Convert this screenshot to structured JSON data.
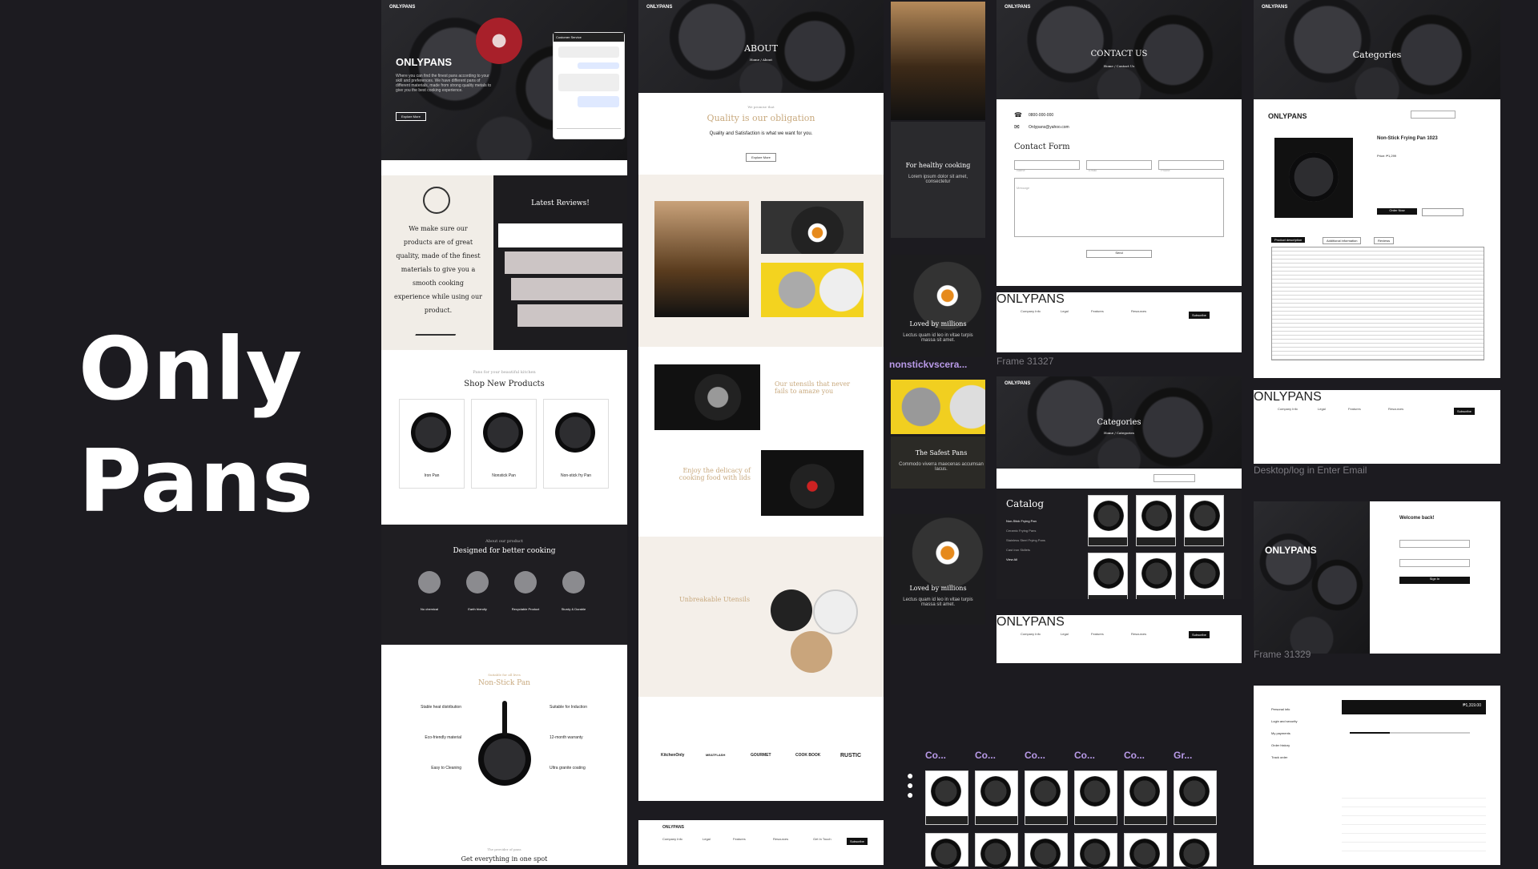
{
  "title": {
    "line1": "Only",
    "line2": "Pans"
  },
  "brand": "ONLYPANS",
  "col1": {
    "hero_text": "Where you can find the finest pans according to your skill and preferences. We have different pans of different materials, made from strong quality metals to give you the best cooking experience.",
    "hero_button": "Explore More",
    "chat_title": "Customer Service",
    "quote": "We make sure our products are of great quality, made of the finest materials to give you a smooth cooking experience while using our product.",
    "reviews_title": "Latest Reviews!",
    "shop_sub": "Pans for your beautiful kitchen",
    "shop_title": "Shop New Products",
    "products": [
      "Iron Pan",
      "Nonstick Pan",
      "Non-stick fry Pan"
    ],
    "designed_sub": "About our product",
    "designed_title": "Designed for better cooking",
    "features": [
      "No chemical",
      "Earth friendly",
      "Recyclable Product",
      "Sturdy & Durable"
    ],
    "ns_sub": "Suitable for all lives",
    "ns_title": "Non-Stick Pan",
    "ns_left": [
      "Stable heat distribution",
      "Eco-friendly material",
      "Easy to Cleaning"
    ],
    "ns_right": [
      "Suitable for Induction",
      "12-month warranty",
      "Ultra granite coating"
    ],
    "bottom_sub": "The provider of pans",
    "bottom_title": "Get everything in one spot"
  },
  "col2": {
    "hero": "ABOUT",
    "crumb": "Home / About",
    "q_sub": "We promise that",
    "q_title": "Quality is our obligation",
    "q_text": "Quality and Satisfaction is what we want for you.",
    "q_button": "Explore More",
    "utensils_title": "Our utensils that never fails to amaze you",
    "enjoy_title": "Enjoy the delicacy of cooking food with lids",
    "unbreak_title": "Unbreakable Utensils",
    "brands": [
      "KitchenOnly",
      "MEATFLASH",
      "GOURMET",
      "COOK BOOK",
      "RUSTIC"
    ]
  },
  "col3": {
    "tiles": [
      {
        "title": "For healthy cooking",
        "text": "Lorem ipsum dolor sit amet, consectetur"
      },
      {
        "title": "Loved by millions",
        "text": "Lectus quam id leo in vitae turpis massa sit amet."
      },
      {
        "title": "The Safest Pans",
        "text": "Commodo viverra maecenas accumsan lacus."
      },
      {
        "title": "Loved by millions",
        "text": "Lectus quam id leo in vitae turpis massa sit amet."
      }
    ],
    "component_label": "nonstickvscera..."
  },
  "col4": {
    "contact_hero": "CONTACT US",
    "contact_crumb": "Home / Contact Us",
    "phone": "0800-000-000",
    "email": "Onlypans@yahoo.com",
    "form_title": "Contact Form",
    "fields": [
      "Name",
      "Email",
      "Phone"
    ],
    "message": "Message",
    "send": "Send",
    "frame1": "Frame 31327",
    "cat_hero": "Categories",
    "cat_crumb": "Home / Categories",
    "catalog": "Catalog",
    "catalog_items": [
      "Non-Stick Frying Pan",
      "Ceramic Frying Pans",
      "Stainless Steel Frying Pans",
      "Cast Iron Skillets"
    ],
    "view_all": "View All",
    "comps": [
      "Co...",
      "Co...",
      "Co...",
      "Co...",
      "Co...",
      "Gr..."
    ]
  },
  "col5": {
    "cat_hero": "Categories",
    "product_name": "Non-Stick Frying Pan 1023",
    "price": "Price: ₱1,299",
    "order_now": "Order Now",
    "tabs": [
      "Product description",
      "Additional information",
      "Reviews"
    ],
    "frame_desktop": "Desktop/log in Enter Email",
    "welcome": "Welcome back!",
    "login_brand": "ONLYPANS",
    "sign_in": "Sign In",
    "frame2": "Frame 31329",
    "order_total": "₱1,319.00",
    "account_menu": [
      "Personal info",
      "Login and security",
      "My payments",
      "Order history",
      "Track order"
    ]
  },
  "footer": {
    "brand": "ONLYPANS",
    "cols": [
      [
        "Company Info",
        "About Us",
        "Carrier",
        "We Are Hiring",
        "Blog"
      ],
      [
        "Legal",
        "About Us",
        "Carrier",
        "We Are Hiring",
        "Blog"
      ],
      [
        "Features",
        "Business Marketing",
        "User Analytic",
        "Live Chat",
        "Unlimited Support"
      ],
      [
        "Resources",
        "IOS & Android",
        "Watch a Demo",
        "Customers",
        "API"
      ]
    ],
    "touch": "Get In Touch",
    "subscribe": "Subscribe"
  },
  "colors": {
    "bg": "#1c1b20",
    "accent": "#c8a97e",
    "frame_label": "#7b7a80",
    "component": "#b99ae8"
  }
}
